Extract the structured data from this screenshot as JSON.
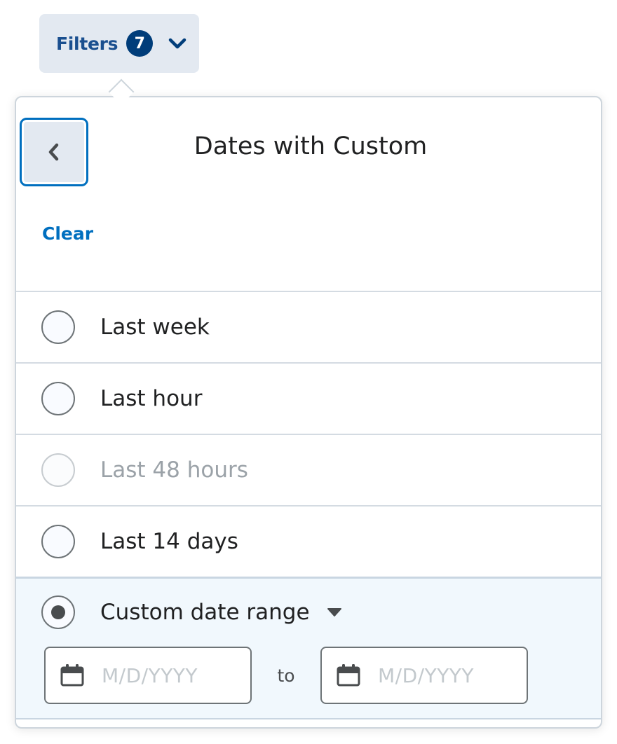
{
  "filters": {
    "label": "Filters",
    "count": "7"
  },
  "panel": {
    "title": "Dates with Custom",
    "clear_label": "Clear",
    "options": [
      {
        "label": "Last week",
        "state": "unselected"
      },
      {
        "label": "Last hour",
        "state": "unselected"
      },
      {
        "label": "Last 48 hours",
        "state": "disabled"
      },
      {
        "label": "Last 14 days",
        "state": "unselected"
      },
      {
        "label": "Custom date range",
        "state": "selected"
      }
    ],
    "custom_range": {
      "start_placeholder": "M/D/YYYY",
      "to_label": "to",
      "end_placeholder": "M/D/YYYY"
    }
  },
  "colors": {
    "accent": "#006fbf",
    "badge": "#003d7a",
    "button_bg": "#e3e9f1",
    "selected_row_bg": "#f1f8fd"
  },
  "icons": {
    "filters_expand": "chevron-down-icon",
    "back": "chevron-left-icon",
    "custom_expand": "caret-down-icon",
    "date_picker": "calendar-icon"
  }
}
